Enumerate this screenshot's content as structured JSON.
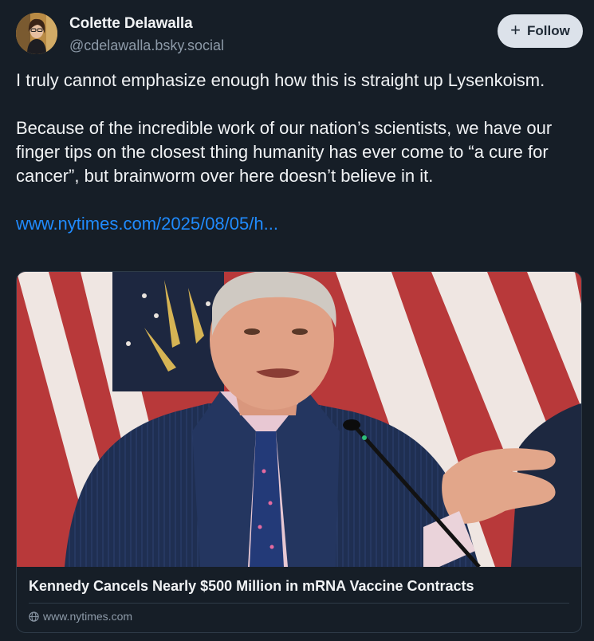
{
  "author": {
    "display_name": "Colette Delawalla",
    "handle": "@cdelawalla.bsky.social",
    "avatar_icon": "avatar-photo"
  },
  "follow_button": {
    "icon": "plus-icon",
    "icon_glyph": "+",
    "label": "Follow"
  },
  "post": {
    "paragraph_1": "I truly cannot emphasize enough how this is straight up Lysenkoism.",
    "paragraph_2": "Because of the incredible work of our nation’s scientists, we have our finger tips on the closest thing humanity has ever come to “a cure for cancer”, but brainworm over here doesn’t believe in it.",
    "link_text": "www.nytimes.com/2025/08/05/h..."
  },
  "link_card": {
    "image_icon": "news-photo",
    "title": "Kennedy Cancels Nearly $500 Million in mRNA Vaccine Contracts",
    "domain_icon": "globe-icon",
    "domain": "www.nytimes.com"
  },
  "colors": {
    "background": "#161e27",
    "link": "#208bfe",
    "muted": "#8d9aa8",
    "follow_bg": "#dce2ea"
  }
}
